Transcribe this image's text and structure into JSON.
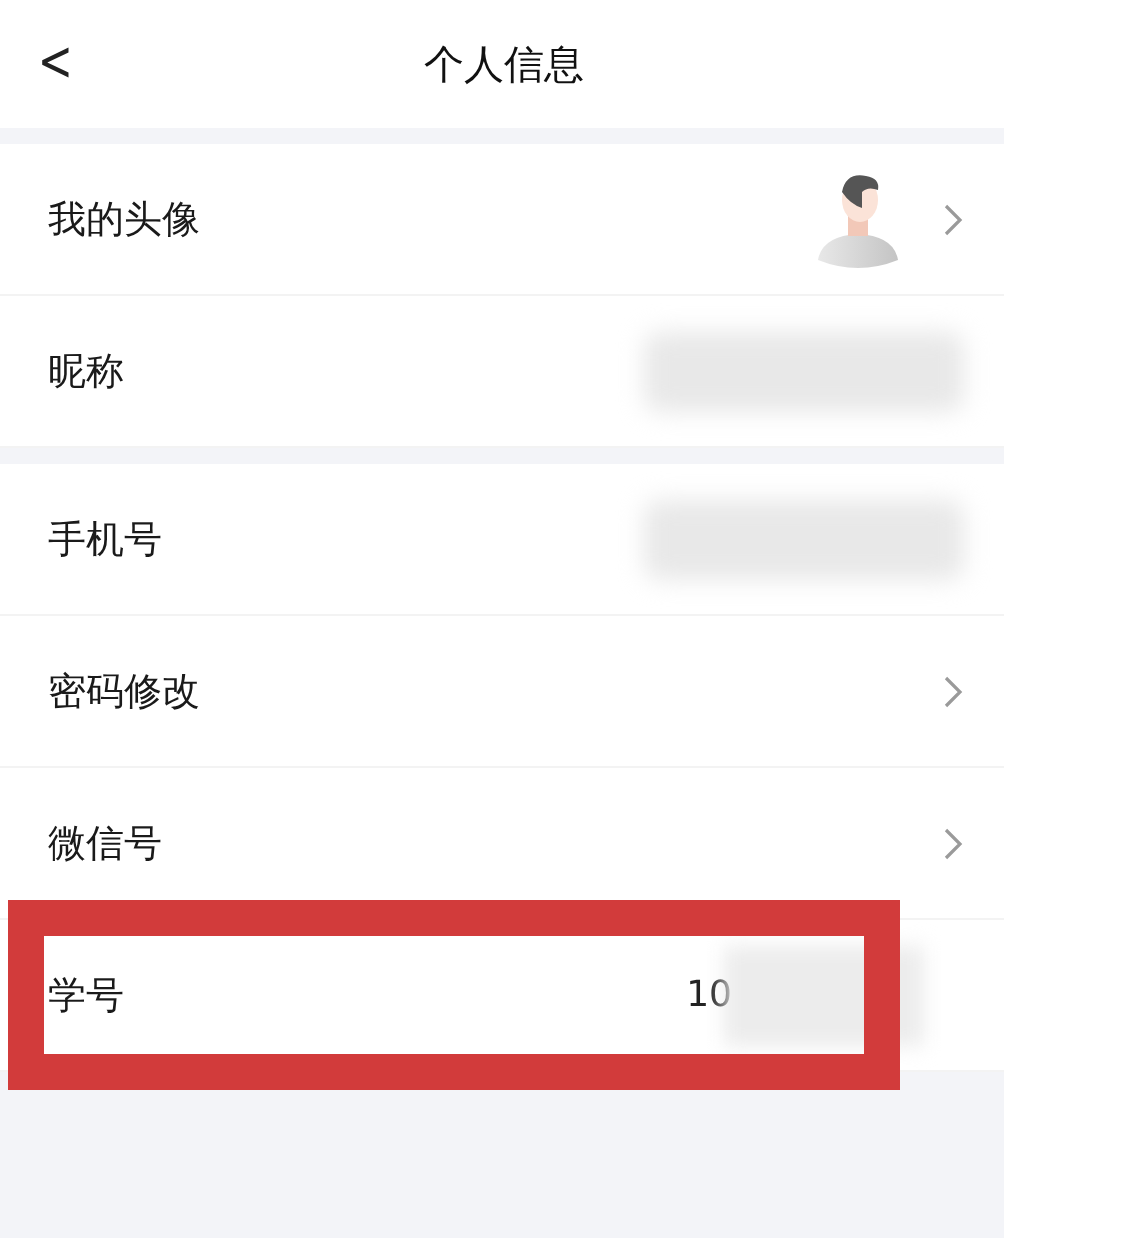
{
  "header": {
    "back_icon": "<",
    "title": "个人信息"
  },
  "sections": [
    [
      {
        "label": "我的头像",
        "kind": "avatar",
        "highlighted": false
      },
      {
        "label": "昵称",
        "kind": "hidden",
        "highlighted": false
      }
    ],
    [
      {
        "label": "手机号",
        "kind": "hidden",
        "highlighted": false
      },
      {
        "label": "密码修改",
        "kind": "link",
        "highlighted": false
      },
      {
        "label": "微信号",
        "kind": "link",
        "highlighted": false
      },
      {
        "label": "学号",
        "kind": "value",
        "value": "10",
        "highlighted": true
      }
    ]
  ]
}
